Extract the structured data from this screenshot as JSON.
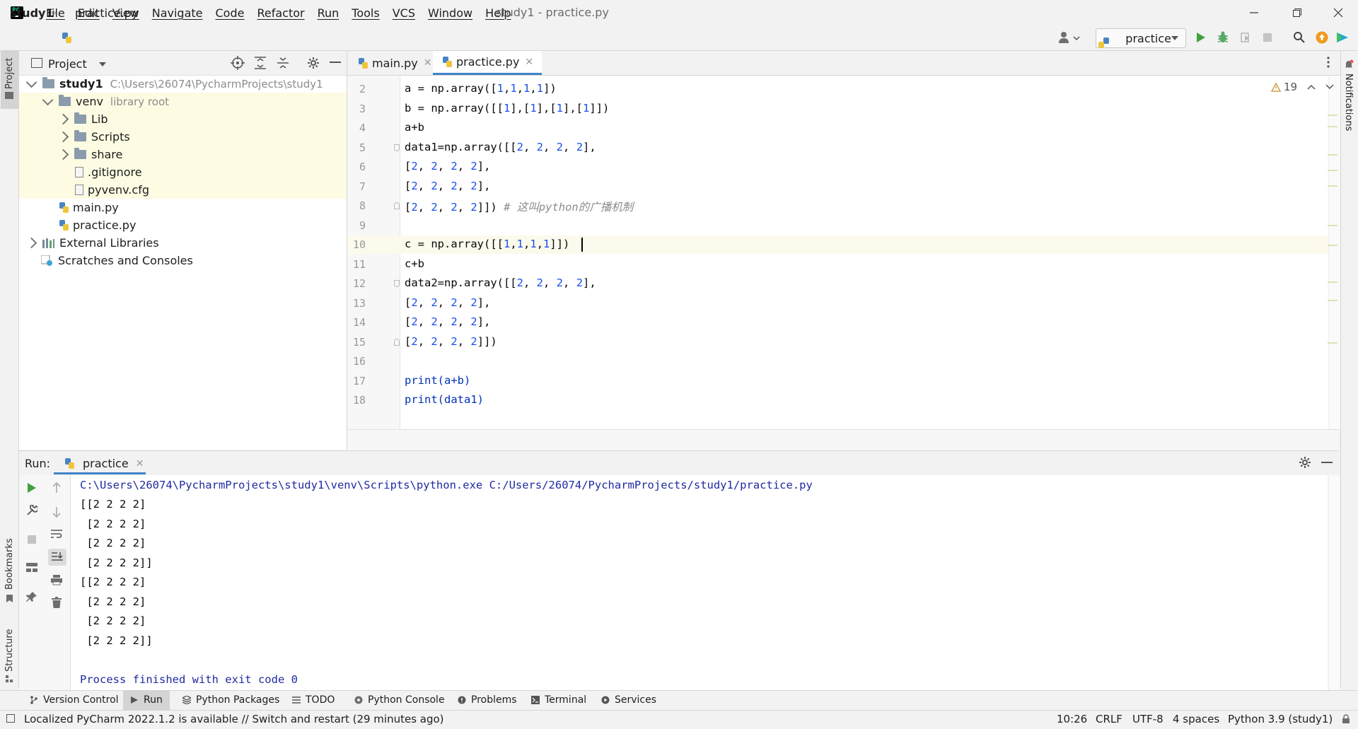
{
  "title_bar": {
    "menu": [
      "File",
      "Edit",
      "View",
      "Navigate",
      "Code",
      "Refactor",
      "Run",
      "Tools",
      "VCS",
      "Window",
      "Help"
    ],
    "window_title": "study1 - practice.py"
  },
  "nav": {
    "project": "study1",
    "file": "practice.py",
    "run_config": "practice"
  },
  "left_stripe": {
    "project": "Project",
    "bookmarks": "Bookmarks",
    "structure": "Structure"
  },
  "right_stripe": {
    "notifications": "Notifications"
  },
  "project_panel": {
    "title": "Project",
    "tree": [
      {
        "label": "study1",
        "hint": "C:\\Users\\26074\\PycharmProjects\\study1"
      },
      {
        "label": "venv",
        "hint": "library root"
      },
      {
        "label": "Lib"
      },
      {
        "label": "Scripts"
      },
      {
        "label": "share"
      },
      {
        "label": ".gitignore"
      },
      {
        "label": "pyvenv.cfg"
      },
      {
        "label": "main.py"
      },
      {
        "label": "practice.py"
      },
      {
        "label": "External Libraries"
      },
      {
        "label": "Scratches and Consoles"
      }
    ]
  },
  "editor": {
    "tabs": [
      "main.py",
      "practice.py"
    ],
    "warnings": "19",
    "line_numbers": [
      "2",
      "3",
      "4",
      "5",
      "6",
      "7",
      "8",
      "9",
      "10",
      "11",
      "12",
      "13",
      "14",
      "15",
      "16",
      "17",
      "18"
    ],
    "lines": [
      "a = np.array([1,1,1,1])",
      "b = np.array([[1],[1],[1],[1]])",
      "a+b",
      "data1=np.array([[2, 2, 2, 2],",
      "[2, 2, 2, 2],",
      "[2, 2, 2, 2],",
      "[2, 2, 2, 2]])",
      "",
      "c = np.array([[1,1,1,1]])",
      "c+b",
      "data2=np.array([[2, 2, 2, 2],",
      "[2, 2, 2, 2],",
      "[2, 2, 2, 2],",
      "[2, 2, 2, 2]])",
      "",
      "print(a+b)",
      "print(data1)"
    ],
    "comment": "# 这叫python的广播机制"
  },
  "run_panel": {
    "label": "Run:",
    "tab": "practice",
    "output": [
      "C:\\Users\\26074\\PycharmProjects\\study1\\venv\\Scripts\\python.exe C:/Users/26074/PycharmProjects/study1/practice.py",
      "[[2 2 2 2]",
      " [2 2 2 2]",
      " [2 2 2 2]",
      " [2 2 2 2]]",
      "[[2 2 2 2]",
      " [2 2 2 2]",
      " [2 2 2 2]",
      " [2 2 2 2]]",
      "",
      "Process finished with exit code 0"
    ]
  },
  "toolbar": {
    "version_control": "Version Control",
    "run": "Run",
    "python_packages": "Python Packages",
    "todo": "TODO",
    "python_console": "Python Console",
    "problems": "Problems",
    "terminal": "Terminal",
    "services": "Services"
  },
  "status": {
    "message": "Localized PyCharm 2022.1.2 is available // Switch and restart (29 minutes ago)",
    "position": "10:26",
    "line_sep": "CRLF",
    "encoding": "UTF-8",
    "indent": "4 spaces",
    "interpreter": "Python 3.9 (study1)"
  },
  "colors": {
    "accent": "#4083c9",
    "number": "#1750eb",
    "comment": "#8c8c8c",
    "run_green": "#3fa23f"
  }
}
